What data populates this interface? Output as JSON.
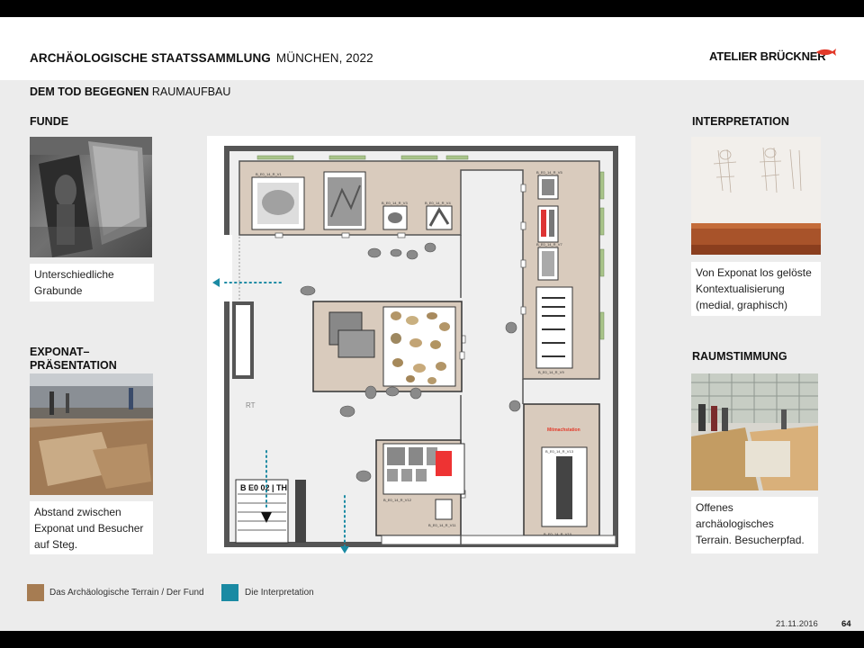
{
  "header": {
    "title_bold": "ARCHÄOLOGISCHE STAATSSAMMLUNG",
    "title_light": "MÜNCHEN, 2022",
    "logo": "ATELIER BRÜCKNER"
  },
  "subtitle": {
    "bold": "DEM TOD BEGEGNEN",
    "light": "RAUMAUFBAU"
  },
  "sections": {
    "funde": {
      "heading": "FUNDE",
      "caption_1": "Unterschiedliche",
      "caption_2": "Grabunde"
    },
    "exponat": {
      "heading_1": "EXPONAT–",
      "heading_2": "PRÄSENTATION",
      "caption_1": "Abstand zwischen",
      "caption_2": "Exponat und Besucher",
      "caption_3": "auf Steg."
    },
    "interpretation": {
      "heading": "INTERPRETATION",
      "caption_1": "Von Exponat los gelöste",
      "caption_2": "Kontextualisierung",
      "caption_3": "(medial, graphisch)"
    },
    "raumstimmung": {
      "heading": "RAUMSTIMMUNG",
      "caption_1": "Offenes",
      "caption_2": "archäologisches",
      "caption_3": "Terrain. Besucherpfad."
    }
  },
  "plan": {
    "labels": {
      "rt": "RT",
      "room_code": "B E0 02 | TH",
      "station": "Mitmachstation",
      "v1": "B_E0_14_R_V1",
      "v2": "B_E0_14_R_V2",
      "v3": "B_E0_14_R_V3",
      "v4": "B_E0_14_R_V4",
      "v5": "B_E0_14_R_V5",
      "v6": "B_E0_14_R_V6",
      "v7": "B_E0_14_R_V7",
      "v8": "B_E0_14_R_V8",
      "v9": "B_E0_14_R_V9",
      "v10": "B_E0_14_R_V10",
      "v11": "B_E0_14_R_V11",
      "v12": "B_E0_14_R_V12",
      "v13": "B_E0_14_R_V13"
    },
    "colors": {
      "terrain": "#d9cbbd",
      "interpretation": "#1a8aa3",
      "wall": "#555555"
    }
  },
  "legend": {
    "item1": {
      "label": "Das Archäologische Terrain / Der Fund",
      "color": "#a67c52"
    },
    "item2": {
      "label": "Die Interpretation",
      "color": "#1a8aa3"
    }
  },
  "footer": {
    "date": "21.11.2016",
    "page": "64"
  }
}
